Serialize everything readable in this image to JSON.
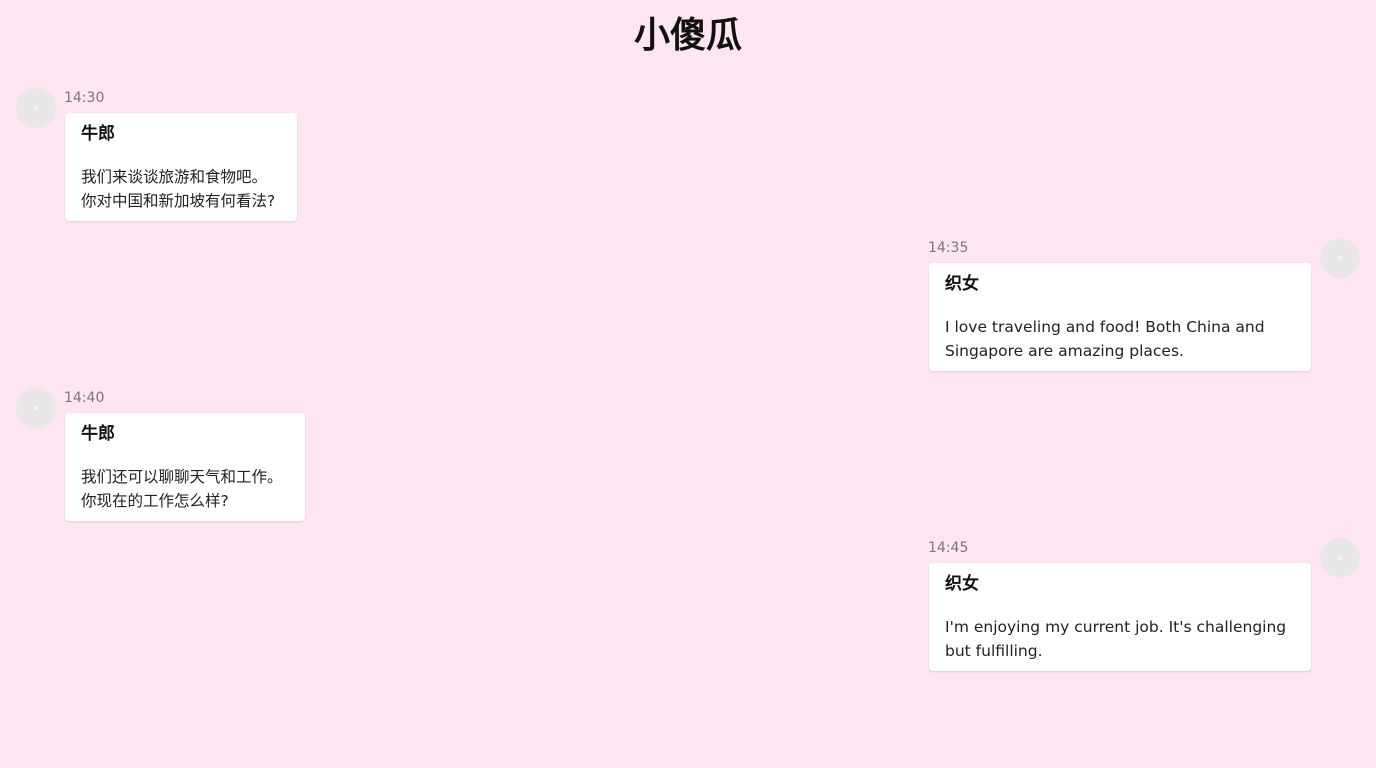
{
  "header": {
    "title": "小傻瓜"
  },
  "messages": [
    {
      "time": "14:30",
      "sender": "牛郎",
      "lines": [
        "我们来谈谈旅游和食物吧。",
        "你对中国和新加坡有何看法?"
      ],
      "side": "left"
    },
    {
      "time": "14:35",
      "sender": "织女",
      "lines": [
        "I love traveling and food! Both China and",
        "Singapore are amazing places."
      ],
      "side": "right"
    },
    {
      "time": "14:40",
      "sender": "牛郎",
      "lines": [
        "我们还可以聊聊天气和工作。",
        "你现在的工作怎么样?"
      ],
      "side": "left"
    },
    {
      "time": "14:45",
      "sender": "织女",
      "lines": [
        "I'm enjoying my current job. It's challenging",
        "but fulfilling."
      ],
      "side": "right"
    }
  ],
  "colors": {
    "background": "#fde6f2",
    "card": "#ffffff",
    "timestamp": "#7b7480",
    "avatar": "#e9e6e8"
  }
}
